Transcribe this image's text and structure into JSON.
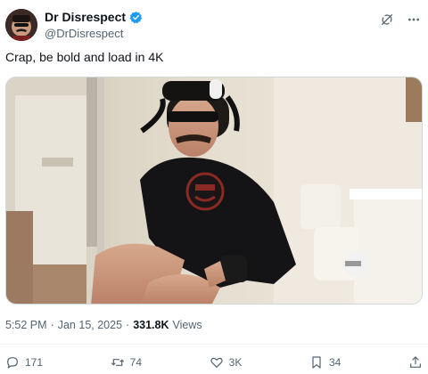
{
  "author": {
    "display_name": "Dr Disrespect",
    "handle": "@DrDisrespect",
    "verified_icon": "verified-badge-icon"
  },
  "header_actions": {
    "grok_icon": "grok-icon",
    "more_icon": "more-icon"
  },
  "tweet": {
    "text": "Crap, be bold and load in 4K"
  },
  "meta": {
    "time": "5:52 PM",
    "separator1": "·",
    "date": "Jan 15, 2025",
    "separator2": "·",
    "views_count": "331.8K",
    "views_label": "Views"
  },
  "actions": {
    "replies": "171",
    "retweets": "74",
    "likes": "3K",
    "bookmarks": "34"
  },
  "colors": {
    "verified": "#1d9bf0",
    "secondary_text": "#536471",
    "primary_text": "#0f1419"
  }
}
